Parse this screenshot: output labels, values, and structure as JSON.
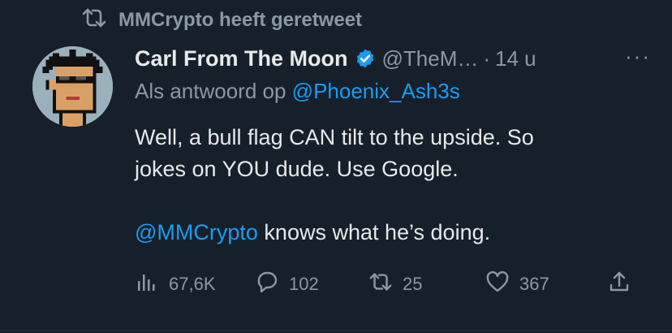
{
  "retweet": {
    "label": "MMCrypto heeft geretweet",
    "icon": "retweet-icon"
  },
  "tweet": {
    "author_name": "Carl From The Moon",
    "handle": "@TheM…",
    "separator": "·",
    "time": "14 u",
    "more": "···",
    "reply_prefix": "Als antwoord op ",
    "reply_handle": "@Phoenix_Ash3s",
    "line1": "Well, a bull flag CAN tilt to the upside. So",
    "line2": "jokes on YOU dude. Use Google.",
    "mention": "@MMCrypto",
    "line3_rest": " knows what he’s doing."
  },
  "actions": {
    "views": "67,6K",
    "replies": "102",
    "retweets": "25",
    "likes": "367"
  },
  "colors": {
    "background": "#15202b",
    "accent": "#1d9bf0",
    "muted": "#8b98a5",
    "text": "#e7e9ea"
  }
}
